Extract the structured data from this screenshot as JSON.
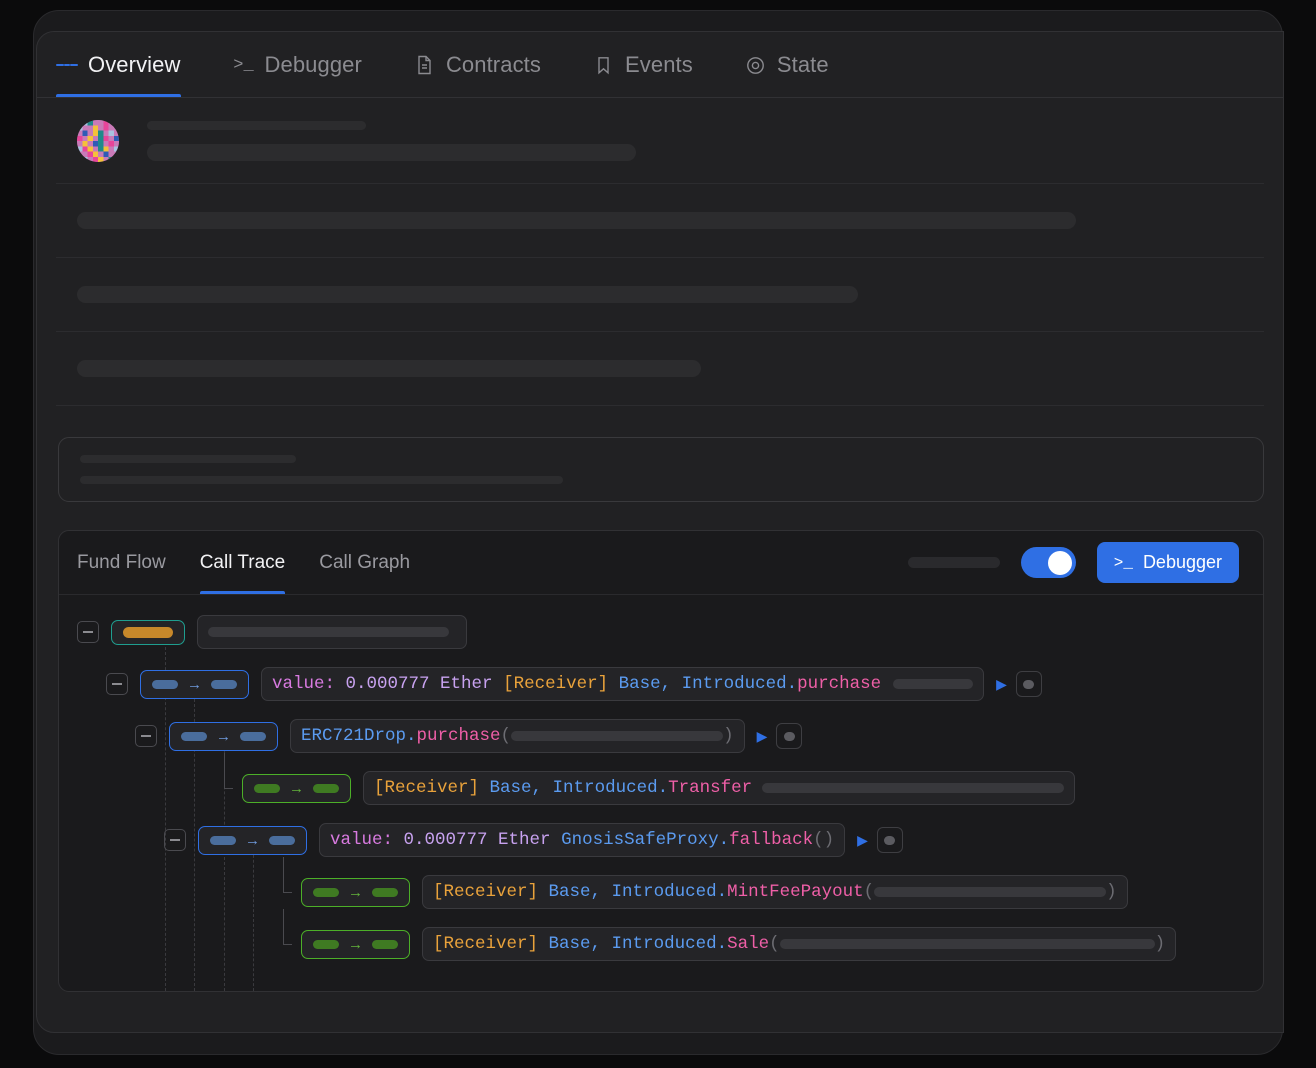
{
  "tabs": [
    {
      "label": "Overview",
      "icon": "list-icon",
      "active": true
    },
    {
      "label": "Debugger",
      "icon": "terminal-icon",
      "active": false
    },
    {
      "label": "Contracts",
      "icon": "document-icon",
      "active": false
    },
    {
      "label": "Events",
      "icon": "bookmark-icon",
      "active": false
    },
    {
      "label": "State",
      "icon": "target-icon",
      "active": false
    }
  ],
  "trace_panel": {
    "tabs": [
      {
        "label": "Fund Flow",
        "active": false
      },
      {
        "label": "Call Trace",
        "active": true
      },
      {
        "label": "Call Graph",
        "active": false
      }
    ],
    "toggle_state": "on",
    "debugger_button": "Debugger",
    "rows": [
      {
        "depth": 0,
        "badge": "teal",
        "type": "root",
        "text": ""
      },
      {
        "depth": 1,
        "badge": "blue",
        "type": "call",
        "key": "value:",
        "value": "0.000777 Ether",
        "receiver": "[Receiver]",
        "contract": "Base, Introduced.",
        "fn": "purchase"
      },
      {
        "depth": 2,
        "badge": "blue",
        "type": "call",
        "contract": "ERC721Drop.",
        "fn": "purchase",
        "args": "("
      },
      {
        "depth": 3,
        "badge": "green",
        "type": "event",
        "receiver": "[Receiver]",
        "contract": "Base, Introduced.",
        "fn": "Transfer"
      },
      {
        "depth": 2,
        "badge": "blue",
        "type": "call",
        "key": "value:",
        "value": "0.000777 Ether",
        "contract": "GnosisSafeProxy.",
        "fn": "fallback",
        "args": "()"
      },
      {
        "depth": 4,
        "badge": "green",
        "type": "event",
        "receiver": "[Receiver]",
        "contract": "Base, Introduced.",
        "fn": "MintFeePayout"
      },
      {
        "depth": 4,
        "badge": "green",
        "type": "event",
        "receiver": "[Receiver]",
        "contract": "Base, Introduced.",
        "fn": "Sale"
      }
    ]
  },
  "colors": {
    "accent": "#2f6fe4",
    "badge_blue": "#2f6fe4",
    "badge_green": "#4caf28",
    "badge_teal": "#1f9e8f",
    "receiver": "#e9a23b",
    "contract": "#5b9bf0",
    "function": "#ee5fa7",
    "value_key": "#d87ae0",
    "value_num": "#c8a2f0"
  }
}
